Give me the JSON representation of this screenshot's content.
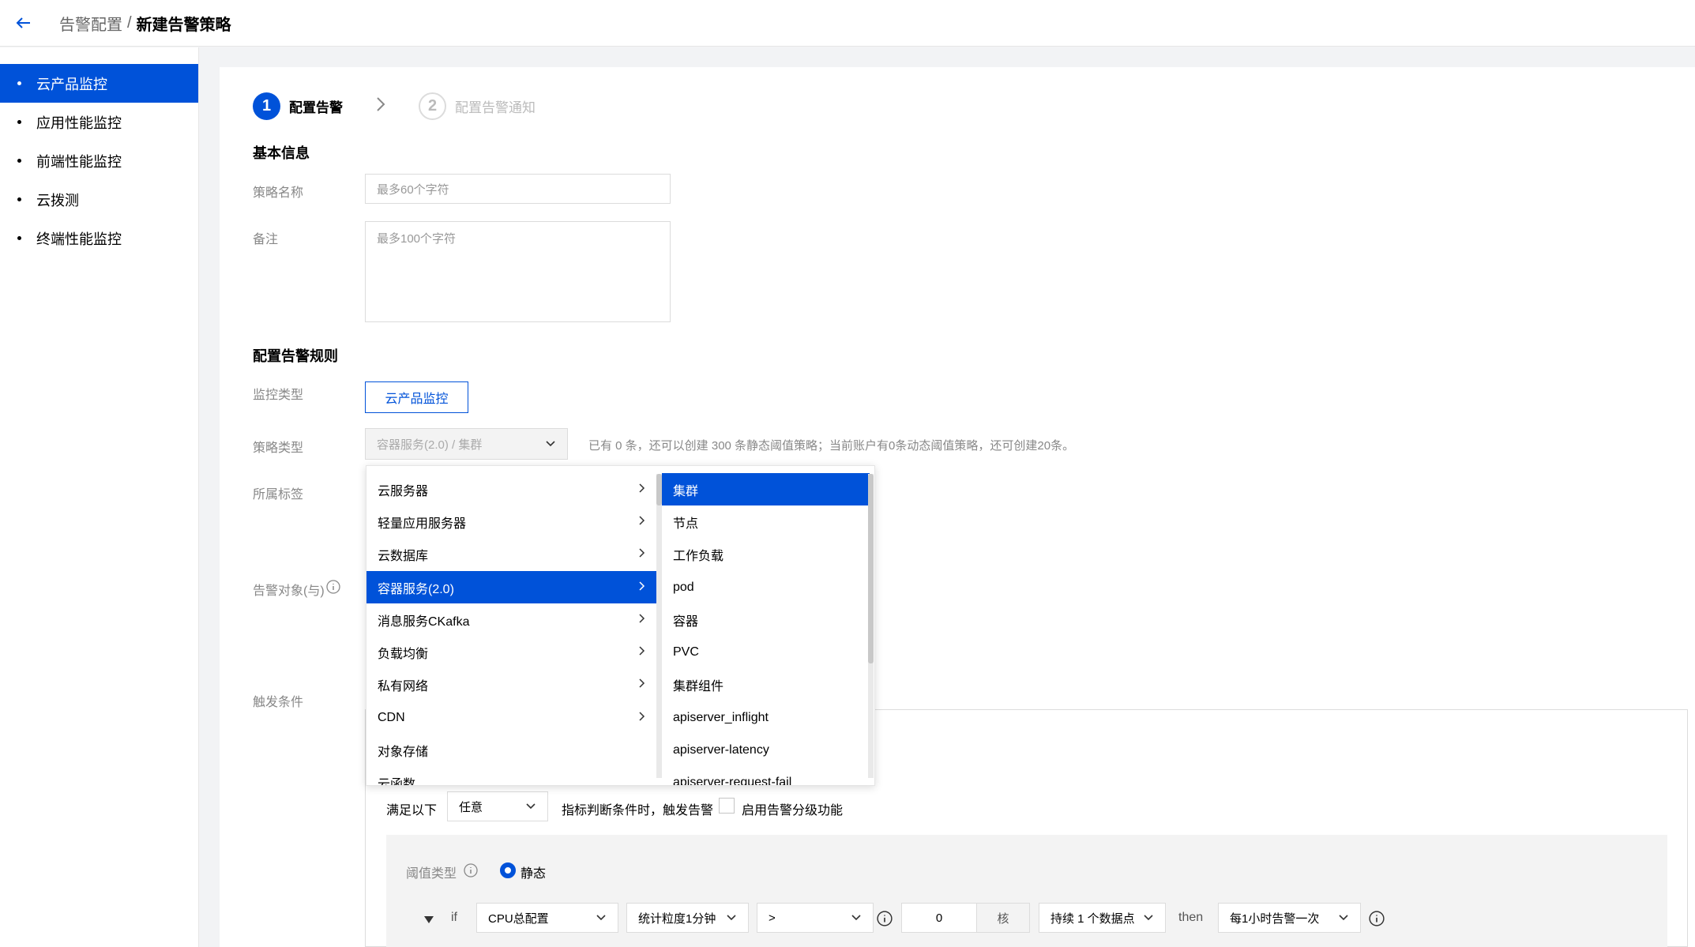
{
  "header": {
    "breadcrumb_parent": "告警配置",
    "breadcrumb_sep": "/",
    "breadcrumb_current": "新建告警策略"
  },
  "sidebar": {
    "items": [
      {
        "label": "云产品监控",
        "active": true
      },
      {
        "label": "应用性能监控"
      },
      {
        "label": "前端性能监控"
      },
      {
        "label": "云拨测"
      },
      {
        "label": "终端性能监控"
      }
    ]
  },
  "steps": [
    {
      "num": "1",
      "label": "配置告警"
    },
    {
      "num": "2",
      "label": "配置告警通知"
    }
  ],
  "basic": {
    "title": "基本信息",
    "name_label": "策略名称",
    "name_placeholder": "最多60个字符",
    "note_label": "备注",
    "note_placeholder": "最多100个字符"
  },
  "rules": {
    "title": "配置告警规则",
    "monitor_type_label": "监控类型",
    "monitor_type_value": "云产品监控",
    "policy_type_label": "策略类型",
    "policy_type_value": "容器服务(2.0) / 集群",
    "policy_hint": "已有 0 条，还可以创建 300 条静态阈值策略；当前账户有0条动态阈值策略，还可创建20条。",
    "tags_label": "所属标签",
    "target_label": "告警对象(与)",
    "trigger_label": "触发条件"
  },
  "dropdown": {
    "left": [
      "云服务器",
      "轻量应用服务器",
      "云数据库",
      "容器服务(2.0)",
      "消息服务CKafka",
      "负载均衡",
      "私有网络",
      "CDN",
      "对象存储",
      "云函数"
    ],
    "right": [
      "集群",
      "节点",
      "工作负载",
      "pod",
      "容器",
      "PVC",
      "集群组件",
      "apiserver_inflight",
      "apiserver-latency",
      "apiserver-request-fail"
    ]
  },
  "condition": {
    "satisfy_prefix": "满足以下",
    "satisfy_value": "任意",
    "satisfy_suffix": "指标判断条件时，触发告警",
    "enable_levels": "启用告警分级功能",
    "threshold_label": "阈值类型",
    "threshold_static": "静态",
    "if_label": "if",
    "metric": "CPU总配置",
    "granularity": "统计粒度1分钟",
    "operator": ">",
    "value": "0",
    "unit": "核",
    "duration": "持续 1 个数据点",
    "then_label": "then",
    "frequency": "每1小时告警一次"
  },
  "colors": {
    "primary": "#0052d9",
    "border": "#dcdcdc"
  }
}
